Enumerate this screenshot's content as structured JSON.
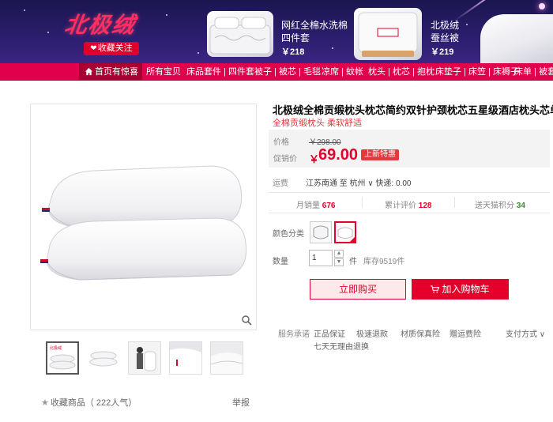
{
  "banner": {
    "logo_text": "北极绒",
    "favorite_label": "收藏关注",
    "promo1": {
      "title_line1": "网红全棉水洗棉",
      "title_line2": "四件套",
      "price": "￥218"
    },
    "promo2": {
      "title_line1": "北极绒",
      "title_line2": "蚕丝被",
      "price": "￥219"
    }
  },
  "nav": {
    "home_label": "首页有惊喜",
    "items": [
      "所有宝贝",
      "床品套件 | 四件套",
      "被子 | 被芯 | 毛毯",
      "凉席 | 蚊帐",
      "枕头 | 枕芯 | 抱枕",
      "床垫子 | 床笠 | 床褥子",
      "床单 | 被套"
    ]
  },
  "product": {
    "title": "北极绒全棉贡缎枕头枕芯简约双针护颈枕芯五星级酒店枕头芯单只装",
    "subtitle": "全棉贡缎枕头 柔软舒适",
    "price_label": "价格",
    "original_price": "￥298.00",
    "promo_price_label": "促销价",
    "currency": "￥",
    "promo_price": "69.00",
    "promo_tag": "上新特惠",
    "shipping_label": "运费",
    "shipping_value": "江苏南通 至 杭州 ∨ 快递: 0.00",
    "monthly_sales_label": "月销量",
    "monthly_sales": "676",
    "reviews_label": "累计评价",
    "reviews": "128",
    "points_label": "送天猫积分",
    "points": "34",
    "color_label": "颜色分类",
    "quantity_label": "数量",
    "quantity_value": "1",
    "unit": "件",
    "stock": "库存9519件",
    "buy_now": "立即购买",
    "add_to_cart": "加入购物车",
    "service_label": "服务承诺",
    "services": [
      "正品保证",
      "极速退款",
      "材质保真险",
      "赠运费险"
    ],
    "service_extra": "七天无理由退换",
    "payment_label": "支付方式 ∨"
  },
  "gallery": {
    "favorite_text": "收藏商品",
    "popularity": "（ 222人气）",
    "report": "举报"
  },
  "colors": {
    "brand_red": "#e4002b",
    "nav_bg": "#e1004b",
    "banner_bg": "#2a1d6b"
  }
}
